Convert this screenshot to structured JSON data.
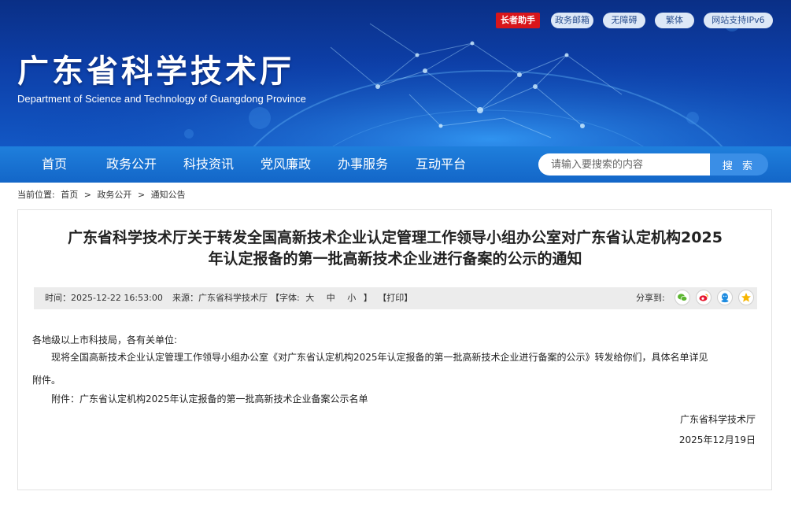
{
  "header": {
    "title": "广东省科学技术厅",
    "subtitle": "Department of Science and Technology of Guangdong Province",
    "top_links": [
      "长者助手",
      "政务邮箱",
      "无障碍",
      "繁体",
      "网站支持IPv6"
    ],
    "colors": {
      "brand_dark": "#0a2f86",
      "nav": "#1366c8",
      "accent_red": "#d8161b"
    }
  },
  "nav": {
    "items": [
      "首页",
      "政务公开",
      "科技资讯",
      "党风廉政",
      "办事服务",
      "互动平台"
    ],
    "search_placeholder": "请输入要搜索的内容",
    "search_button": "搜 索"
  },
  "breadcrumb": {
    "prefix": "当前位置:",
    "items": [
      "首页",
      "政务公开",
      "通知公告"
    ],
    "separator": ">"
  },
  "article": {
    "title_line1": "广东省科学技术厅关于转发全国高新技术企业认定管理工作领导小组办公室对广东省认定机构2025",
    "title_line2": "年认定报备的第一批高新技术企业进行备案的公示的通知",
    "meta": {
      "time_label": "时间：",
      "time": "2025-12-22 16:53:00",
      "source_label": "来源：",
      "source": "广东省科学技术厅",
      "font_label": "【字体:",
      "font_sizes": [
        "大",
        "中",
        "小"
      ],
      "font_close": "】",
      "print": "【打印】",
      "share_label": "分享到:",
      "share_icons": [
        "wechat-icon",
        "weibo-icon",
        "qq-icon",
        "qzone-icon"
      ]
    },
    "salutation": "各地级以上市科技局，各有关单位:",
    "para1_line1": "现将全国高新技术企业认定管理工作领导小组办公室《对广东省认定机构2025年认定报备的第一批高新技术企业进行备案的公示》转发给你们，具体名单详见",
    "para1_line2": "附件。",
    "attachment": "附件：广东省认定机构2025年认定报备的第一批高新技术企业备案公示名单",
    "signature": "广东省科学技术厅",
    "date": "2025年12月19日"
  }
}
